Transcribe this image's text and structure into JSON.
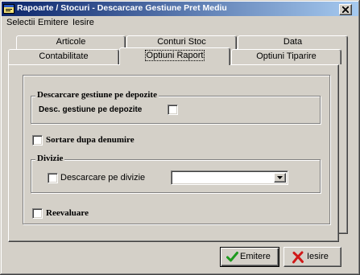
{
  "window": {
    "title": "Rapoarte / Stocuri - Descarcare Gestiune Pret Mediu",
    "icon": "app-icon",
    "close_icon": "close-icon"
  },
  "menu": {
    "items": [
      "Selectii",
      "Emitere",
      "Iesire"
    ]
  },
  "tabs": {
    "back_row": [
      "Articole",
      "Conturi Stoc",
      "Data"
    ],
    "front_row": [
      "Contabilitate",
      "Optiuni Raport",
      "Optiuni Tiparire"
    ],
    "selected_front_index": 1
  },
  "options": {
    "depozite_group": {
      "title": "Descarcare gestiune pe depozite",
      "checkbox": {
        "label": "Desc. gestiune pe depozite",
        "checked": false
      }
    },
    "sortare": {
      "label": "Sortare dupa denumire",
      "checked": false
    },
    "divizie_group": {
      "title": "Divizie",
      "checkbox": {
        "label": "Descarcare pe divizie",
        "checked": false
      },
      "dropdown": {
        "icon": "chevron-down-icon"
      }
    },
    "reevaluare": {
      "label": "Reevaluare",
      "checked": false
    }
  },
  "buttons": {
    "emitere": {
      "label": "Emitere",
      "icon": "checkmark-icon"
    },
    "iesire": {
      "label": "Iesire",
      "icon": "red-x-icon"
    }
  },
  "colors": {
    "face": "#d4d0c8",
    "title_bar_start": "#0a246a",
    "title_bar_end": "#a6caf0",
    "title_text": "#ffffff",
    "emitere_icon": "#1e9a1e",
    "iesire_icon": "#d01818"
  }
}
